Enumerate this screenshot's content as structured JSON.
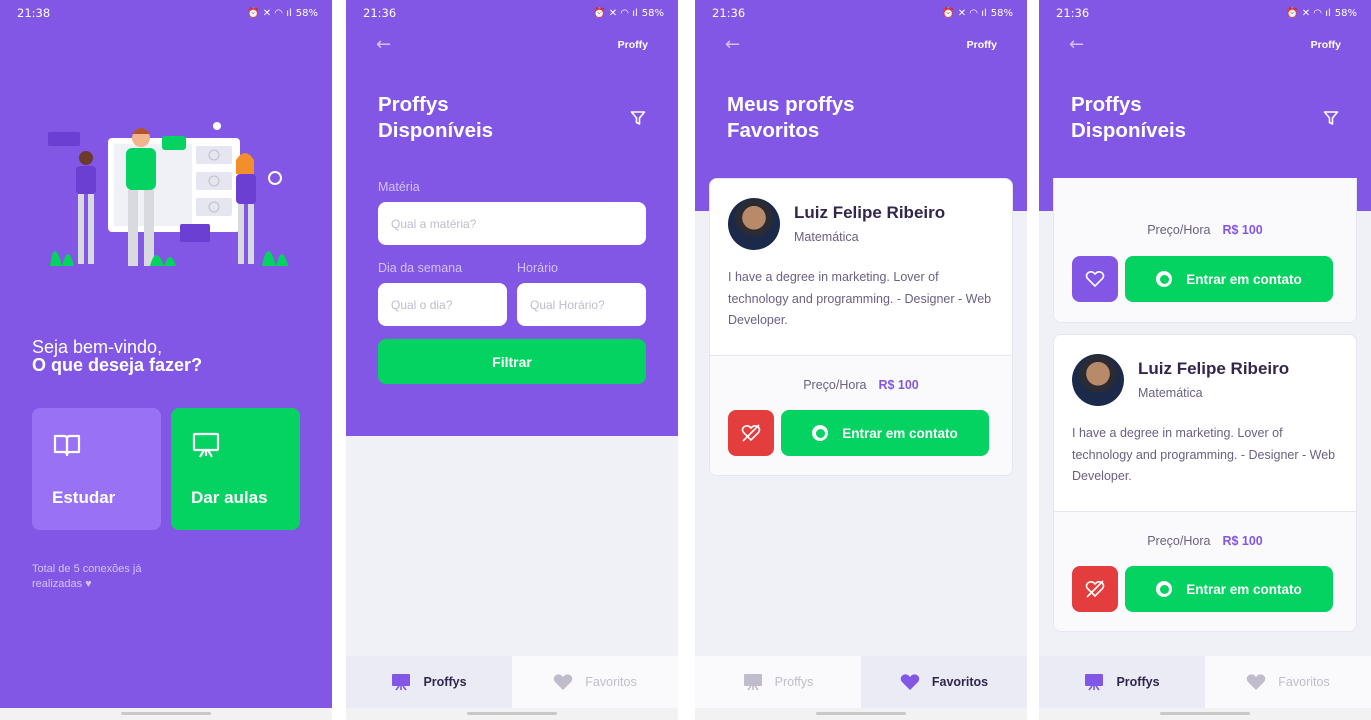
{
  "colors": {
    "primary": "#8257e5",
    "secondary": "#04d361",
    "danger": "#e33d3d",
    "background": "#f0f0f7"
  },
  "screen1": {
    "status": {
      "time": "21:38",
      "battery": "58%"
    },
    "welcome_line1": "Seja bem-vindo,",
    "welcome_line2": "O que deseja fazer?",
    "study_label": "Estudar",
    "give_classes_label": "Dar aulas",
    "total_connections": "Total de 5 conexões já realizadas",
    "icons": [
      "book-open-icon",
      "presentation-icon",
      "heart-icon"
    ]
  },
  "screen2": {
    "status": {
      "time": "21:36",
      "battery": "58%"
    },
    "logo": "Proffy",
    "title_line1": "Proffys",
    "title_line2": "Disponíveis",
    "subject_label": "Matéria",
    "subject_placeholder": "Qual a matéria?",
    "weekday_label": "Dia da semana",
    "weekday_placeholder": "Qual o dia?",
    "time_label": "Horário",
    "time_placeholder": "Qual Horário?",
    "filter_button": "Filtrar",
    "tabs": [
      {
        "label": "Proffys",
        "active": true
      },
      {
        "label": "Favoritos",
        "active": false
      }
    ]
  },
  "screen3": {
    "status": {
      "time": "21:36",
      "battery": "58%"
    },
    "logo": "Proffy",
    "title_line1": "Meus proffys",
    "title_line2": "Favoritos",
    "card": {
      "name": "Luiz Felipe Ribeiro",
      "subject": "Matemática",
      "bio": "I have a degree in marketing. Lover of technology and programming. - Designer - Web Developer.",
      "price_label": "Preço/Hora",
      "price_value": "R$ 100",
      "contact_label": "Entrar em contato",
      "favorited": true
    },
    "tabs": [
      {
        "label": "Proffys",
        "active": false
      },
      {
        "label": "Favoritos",
        "active": true
      }
    ]
  },
  "screen4": {
    "status": {
      "time": "21:36",
      "battery": "58%"
    },
    "logo": "Proffy",
    "title_line1": "Proffys",
    "title_line2": "Disponíveis",
    "partial_card": {
      "price_label": "Preço/Hora",
      "price_value": "R$ 100",
      "contact_label": "Entrar em contato",
      "favorited": false
    },
    "card": {
      "name": "Luiz Felipe Ribeiro",
      "subject": "Matemática",
      "bio": "I have a degree in marketing. Lover of technology and programming. - Designer - Web Developer.",
      "price_label": "Preço/Hora",
      "price_value": "R$ 100",
      "contact_label": "Entrar em contato",
      "favorited": true
    },
    "tabs": [
      {
        "label": "Proffys",
        "active": true
      },
      {
        "label": "Favoritos",
        "active": false
      }
    ]
  }
}
